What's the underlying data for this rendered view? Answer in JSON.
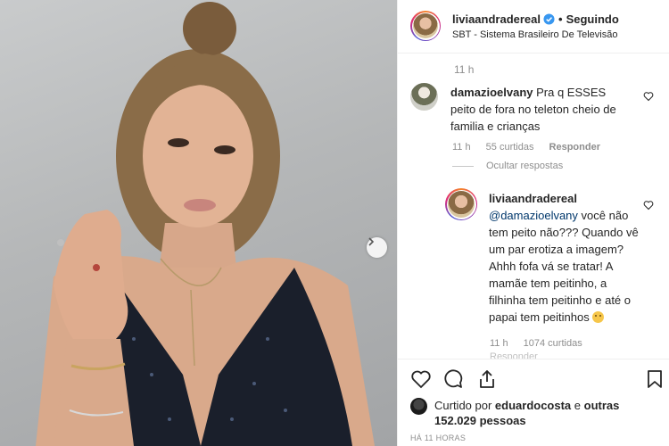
{
  "post": {
    "username": "liviaandradereal",
    "follow_state": "Seguindo",
    "dot": "•",
    "location": "SBT - Sistema Brasileiro De Televisão",
    "time_top": "11 h",
    "post_time": "HÁ 11 HORAS"
  },
  "comment": {
    "username": "damazioelvany",
    "text": "Pra q ESSES peito de fora no teleton cheio de familia e crianças",
    "time": "11 h",
    "likes": "55 curtidas",
    "reply_label": "Responder",
    "hide_replies": "Ocultar respostas"
  },
  "reply": {
    "username": "liviaandradereal",
    "mention": "@damazioelvany",
    "text": " você não tem peito não??? Quando vê um par erotiza a imagem? Ahhh fofa vá se tratar! A mamãe tem peitinho, a filhinha tem peitinho e até o papai tem peitinhos ",
    "time": "11 h",
    "likes": "1074 curtidas",
    "cutoff_label": "Responder"
  },
  "likes_summary": {
    "prefix": "Curtido por ",
    "user": "eduardocosta",
    "middle": " e ",
    "others": "outras 152.029 pessoas"
  },
  "icons": {
    "next": "chevron-right-icon",
    "verified": "verified-badge-icon",
    "like": "heart-icon",
    "comment": "comment-icon",
    "share": "share-icon",
    "save": "bookmark-icon"
  },
  "colors": {
    "verified": "#3897f0",
    "text": "#262626",
    "muted": "#8e8e8e",
    "mention": "#00376b"
  }
}
